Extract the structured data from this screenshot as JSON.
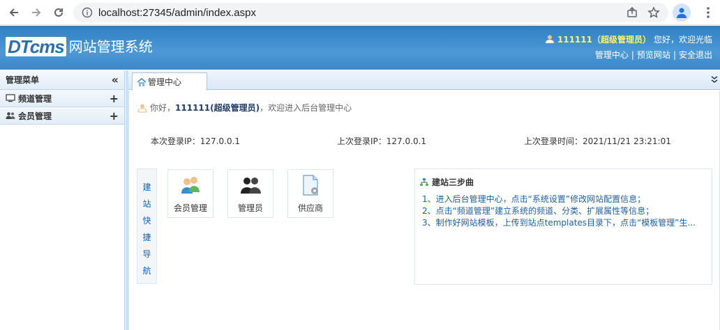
{
  "browser": {
    "url": "localhost:27345/admin/index.aspx"
  },
  "header": {
    "logo_text": "DTcms",
    "system_name": "网站管理系统",
    "user_display": "111111（超级管理员）",
    "greeting": "您好，欢迎光临",
    "links": [
      "管理中心",
      "预览网站",
      "安全退出"
    ],
    "separator": "|"
  },
  "sidebar": {
    "title": "管理菜单",
    "collapse_glyph": "«",
    "items": [
      {
        "label": "频道管理",
        "icon": "monitor-icon",
        "expand": "+"
      },
      {
        "label": "会员管理",
        "icon": "users-icon",
        "expand": "+"
      }
    ]
  },
  "tabs": [
    {
      "label": "管理中心",
      "icon": "home-icon"
    }
  ],
  "welcome": {
    "prefix": "你好，",
    "user": "111111(超级管理员)",
    "suffix": "，欢迎进入后台管理中心"
  },
  "login_info": {
    "this_ip": "本次登录IP：127.0.0.1",
    "last_ip": "上次登录IP：127.0.0.1",
    "last_time": "上次登录时间：2021/11/21 23:21:01"
  },
  "quick_nav": {
    "title_chars": [
      "建",
      "站",
      "快",
      "捷",
      "导",
      "航"
    ],
    "cards": [
      {
        "label": "会员管理",
        "icon": "member-icon"
      },
      {
        "label": "管理员",
        "icon": "admin-icon"
      },
      {
        "label": "供应商",
        "icon": "supplier-icon"
      }
    ]
  },
  "steps": {
    "title": "建站三步曲",
    "items": [
      "1、进入后台管理中心，点击“系统设置”修改网站配置信息；",
      "2、点击“频道管理”建立系统的频道、分类、扩展属性等信息；",
      "3、制作好网站模板，上传到站点templates目录下，点击“模板管理”生..."
    ]
  },
  "colors": {
    "header_blue": "#3b87c8",
    "username_yellow": "#fff36b",
    "link_blue": "#1f5fa0"
  }
}
